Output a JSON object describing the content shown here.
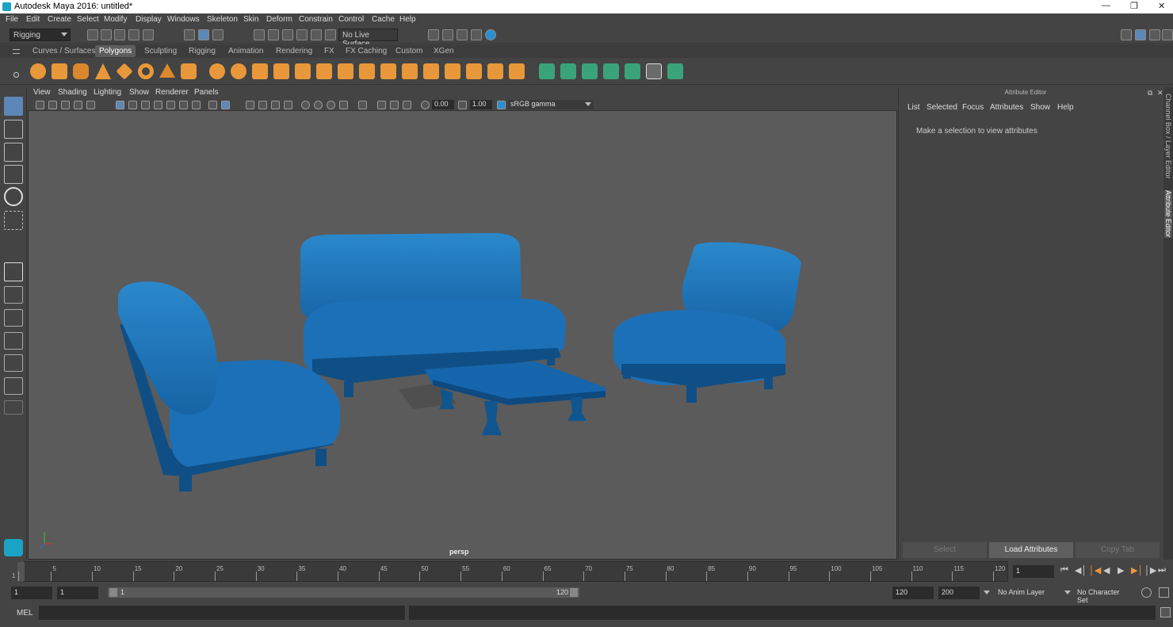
{
  "title": "Autodesk Maya 2016: untitled*",
  "menus": [
    "File",
    "Edit",
    "Create",
    "Select",
    "Modify",
    "Display",
    "Windows",
    "Skeleton",
    "Skin",
    "Deform",
    "Constrain",
    "Control",
    "Cache",
    "Help"
  ],
  "mode_menu": "Rigging",
  "live_surface": "No Live Surface",
  "shelf_tabs": [
    "Curves / Surfaces",
    "Polygons",
    "Sculpting",
    "Rigging",
    "Animation",
    "Rendering",
    "FX",
    "FX Caching",
    "Custom",
    "XGen"
  ],
  "active_shelf_tab": "Polygons",
  "panel_menus": [
    "View",
    "Shading",
    "Lighting",
    "Show",
    "Renderer",
    "Panels"
  ],
  "exposure": "0.00",
  "gamma": "1.00",
  "color_space": "sRGB gamma",
  "camera_label": "persp",
  "attribute_editor": {
    "title": "Attribute Editor",
    "menus": [
      "List",
      "Selected",
      "Focus",
      "Attributes",
      "Show",
      "Help"
    ],
    "message": "Make a selection to view attributes",
    "buttons": [
      "Select",
      "Load Attributes",
      "Copy Tab"
    ]
  },
  "side_tabs": [
    "Channel Box / Layer Editor",
    "Attribute Editor"
  ],
  "timeline": {
    "ticks": [
      "1",
      "5",
      "10",
      "15",
      "20",
      "25",
      "30",
      "35",
      "40",
      "45",
      "50",
      "55",
      "60",
      "65",
      "70",
      "75",
      "80",
      "85",
      "90",
      "95",
      "100",
      "105",
      "110",
      "115",
      "120"
    ],
    "current_frame": "1"
  },
  "range": {
    "start": "1",
    "playback_start": "1",
    "slider_start": "1",
    "slider_end": "120",
    "playback_end": "120",
    "end": "200",
    "anim_layer": "No Anim Layer",
    "character_set": "No Character Set"
  },
  "cmd_label": "MEL",
  "colors": {
    "furniture": "#1f73b8",
    "furniture_dark": "#0f4f85",
    "viewport_bg": "#5b5b5b",
    "shelf_orange": "#e8983a",
    "shelf_green": "#3aa37a"
  },
  "icons": [
    "select-tool-icon",
    "lasso-tool-icon",
    "paint-select-icon",
    "move-tool-icon",
    "rotate-tool-icon",
    "scale-tool-icon",
    "maya-logo-icon",
    "play-icon",
    "axis-indicator-icon"
  ]
}
